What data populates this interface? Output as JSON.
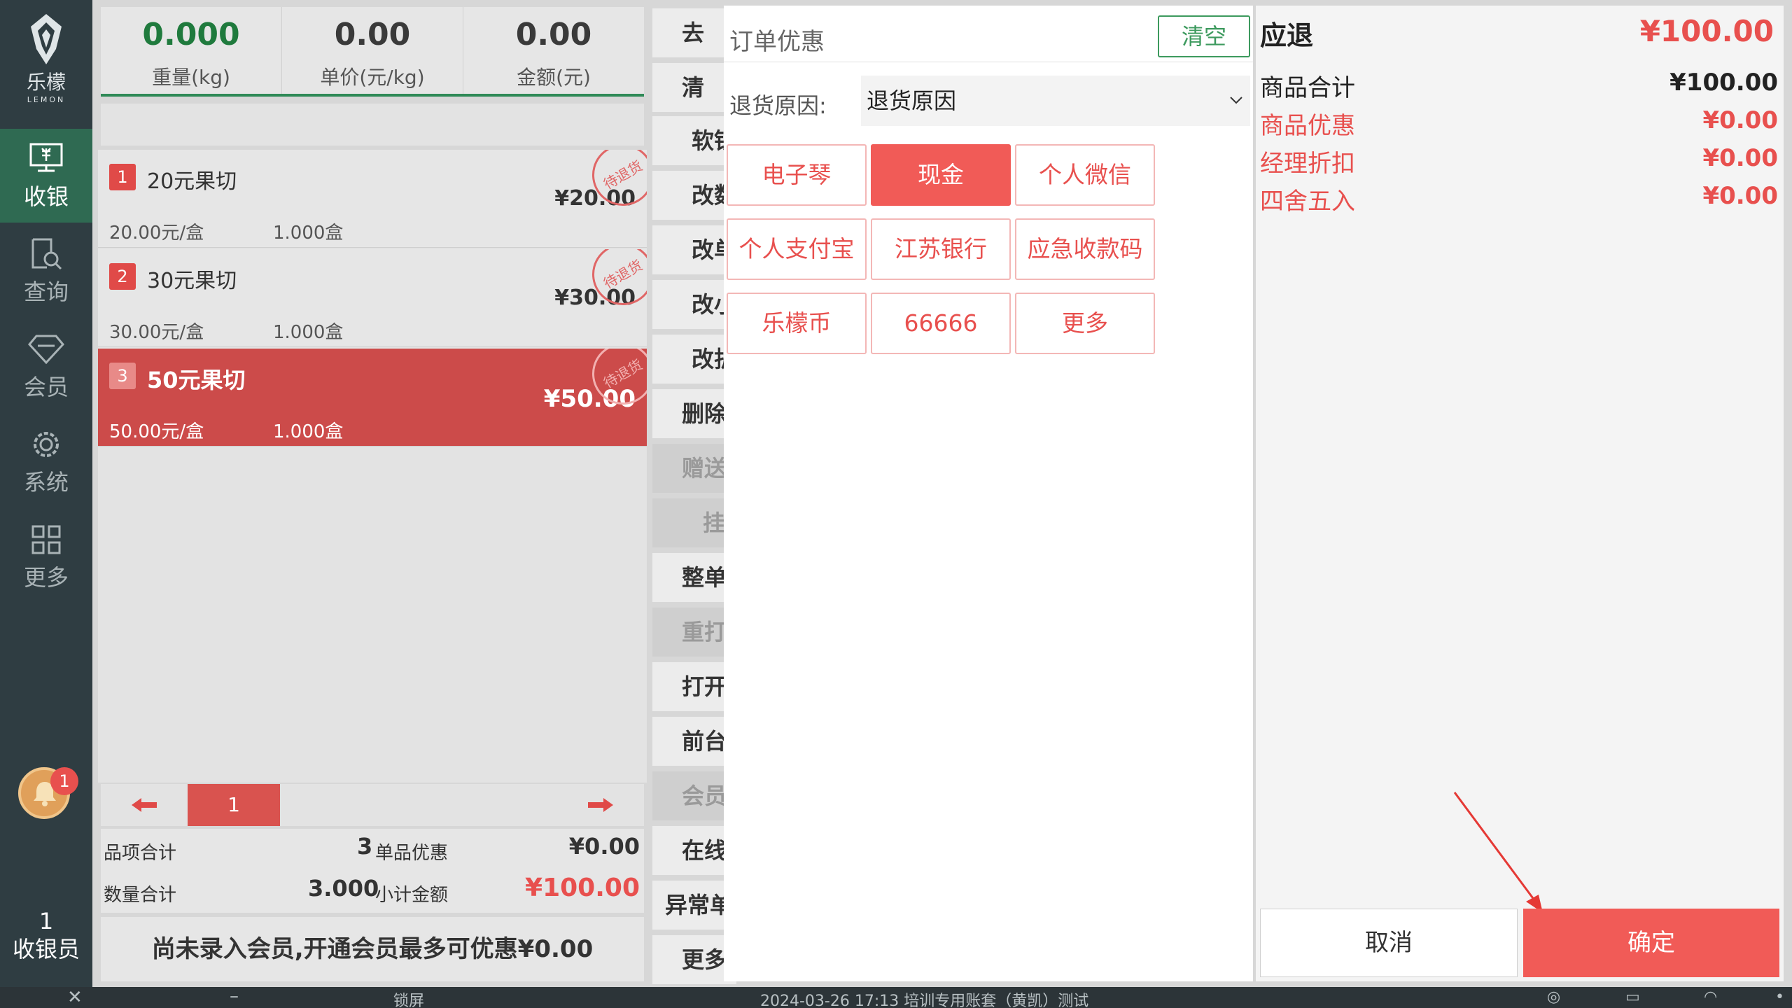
{
  "sidebar": {
    "logo_cn": "乐檬",
    "logo_en": "LEMON",
    "items": [
      {
        "label": "收银",
        "icon": "cashier-icon"
      },
      {
        "label": "查询",
        "icon": "search-doc-icon"
      },
      {
        "label": "会员",
        "icon": "diamond-icon"
      },
      {
        "label": "系统",
        "icon": "gear-icon"
      },
      {
        "label": "更多",
        "icon": "grid-icon"
      }
    ],
    "notification_count": "1",
    "cashier_id": "1",
    "cashier_label": "收银员"
  },
  "scale": {
    "weight": "0.000",
    "weight_label": "重量(kg)",
    "unit_price": "0.00",
    "unit_price_label": "单价(元/kg)",
    "amount": "0.00",
    "amount_label": "金额(元)"
  },
  "cart": {
    "rows": [
      {
        "idx": "1",
        "name": "20元果切",
        "price": "¥20.00",
        "unit_price": "20.00元/盒",
        "qty": "1.000盒",
        "stamp": "待退货"
      },
      {
        "idx": "2",
        "name": "30元果切",
        "price": "¥30.00",
        "unit_price": "30.00元/盒",
        "qty": "1.000盒",
        "stamp": "待退货"
      },
      {
        "idx": "3",
        "name": "50元果切",
        "price": "¥50.00",
        "unit_price": "50.00元/盒",
        "qty": "1.000盒",
        "stamp": "待退货"
      }
    ],
    "page": "1"
  },
  "totals": {
    "items_label": "品项合计",
    "items_value": "3",
    "discount_label": "单品优惠",
    "discount_value": "¥0.00",
    "qty_label": "数量合计",
    "qty_value": "3.000",
    "subtotal_label": "小计金额",
    "subtotal_value": "¥100.00"
  },
  "member_banner": "尚未录入会员,开通会员最多可优惠¥0.00",
  "midcol": [
    {
      "label": "去",
      "dim": false
    },
    {
      "label": "清",
      "dim": false
    },
    {
      "label": "软银",
      "dim": false
    },
    {
      "label": "改数",
      "dim": false
    },
    {
      "label": "改单",
      "dim": false
    },
    {
      "label": "改小",
      "dim": false
    },
    {
      "label": "改折",
      "dim": false
    },
    {
      "label": "删除",
      "dim": false
    },
    {
      "label": "赠送",
      "dim": true
    },
    {
      "label": "挂",
      "dim": true
    },
    {
      "label": "整单",
      "dim": false
    },
    {
      "label": "重打",
      "dim": true
    },
    {
      "label": "打开",
      "dim": false
    },
    {
      "label": "前台",
      "dim": false
    },
    {
      "label": "会员",
      "dim": true
    },
    {
      "label": "在线",
      "dim": false
    },
    {
      "label": "异常单",
      "dim": false
    },
    {
      "label": "更多",
      "dim": false
    }
  ],
  "dialog": {
    "promo_placeholder": "订单优惠",
    "clear_label": "清空",
    "reason_label": "退货原因:",
    "reason_value": "退货原因",
    "payment_methods": [
      "电子琴",
      "现金",
      "个人微信",
      "个人支付宝",
      "江苏银行",
      "应急收款码",
      "乐檬币",
      "66666",
      "更多"
    ],
    "selected_method": "现金"
  },
  "summary": {
    "title": "应退",
    "title_value": "¥100.00",
    "lines": [
      {
        "label": "商品合计",
        "value": "¥100.00",
        "color": "#222222"
      },
      {
        "label": "商品优惠",
        "value": "¥0.00",
        "color": "#e8504e"
      },
      {
        "label": "经理折扣",
        "value": "¥0.00",
        "color": "#e8504e"
      },
      {
        "label": "四舍五入",
        "value": "¥0.00",
        "color": "#e8504e"
      }
    ],
    "cancel_label": "取消",
    "confirm_label": "确定"
  },
  "statusbar": {
    "lock_label": "锁屏",
    "info": "2024-03-26 17:13 培训专用账套（黄凯）测试"
  },
  "colors": {
    "accent_red": "#f15b57",
    "sidebar_bg": "#2f3d42",
    "active_green": "#2f6a52",
    "clear_green": "#3d9a5e"
  }
}
